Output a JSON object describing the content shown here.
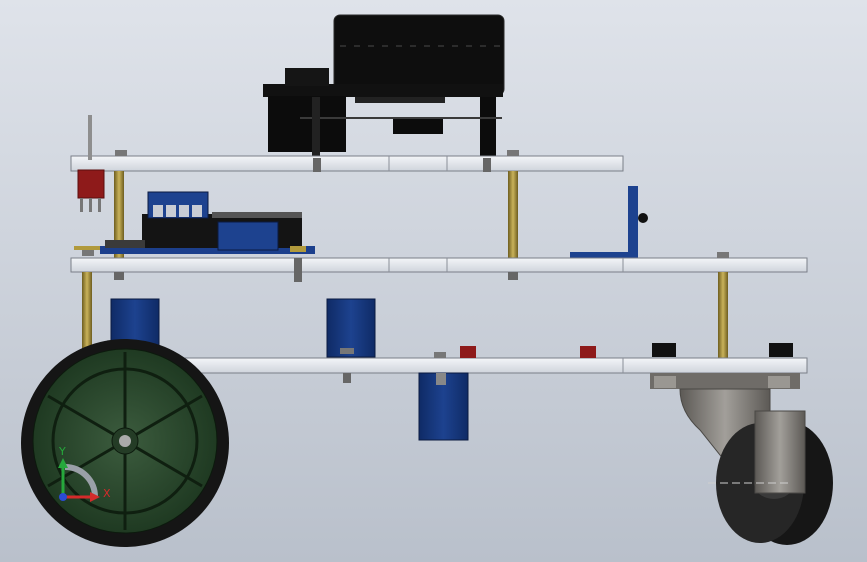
{
  "viewport": {
    "background_top": "#dfe3ea",
    "background_bottom": "#b9c0cb"
  },
  "model": {
    "plate_color": "#e8ecf2",
    "plate_edge": "#7a7f88",
    "standoff_color": "#b19a3c",
    "board_color": "#1c3f8c",
    "motor_color": "#0d0d0d",
    "wheel_tire_color": "#1b1b1b",
    "wheel_hub_color": "#2d4a2f",
    "caster_color": "#8d8a86",
    "connector_red": "#8e1a1a"
  },
  "triad": {
    "y_label": "Y",
    "x_label": "X",
    "y_color": "#26a83c",
    "x_color": "#d42b2b",
    "z_color": "#2b4bd4"
  }
}
